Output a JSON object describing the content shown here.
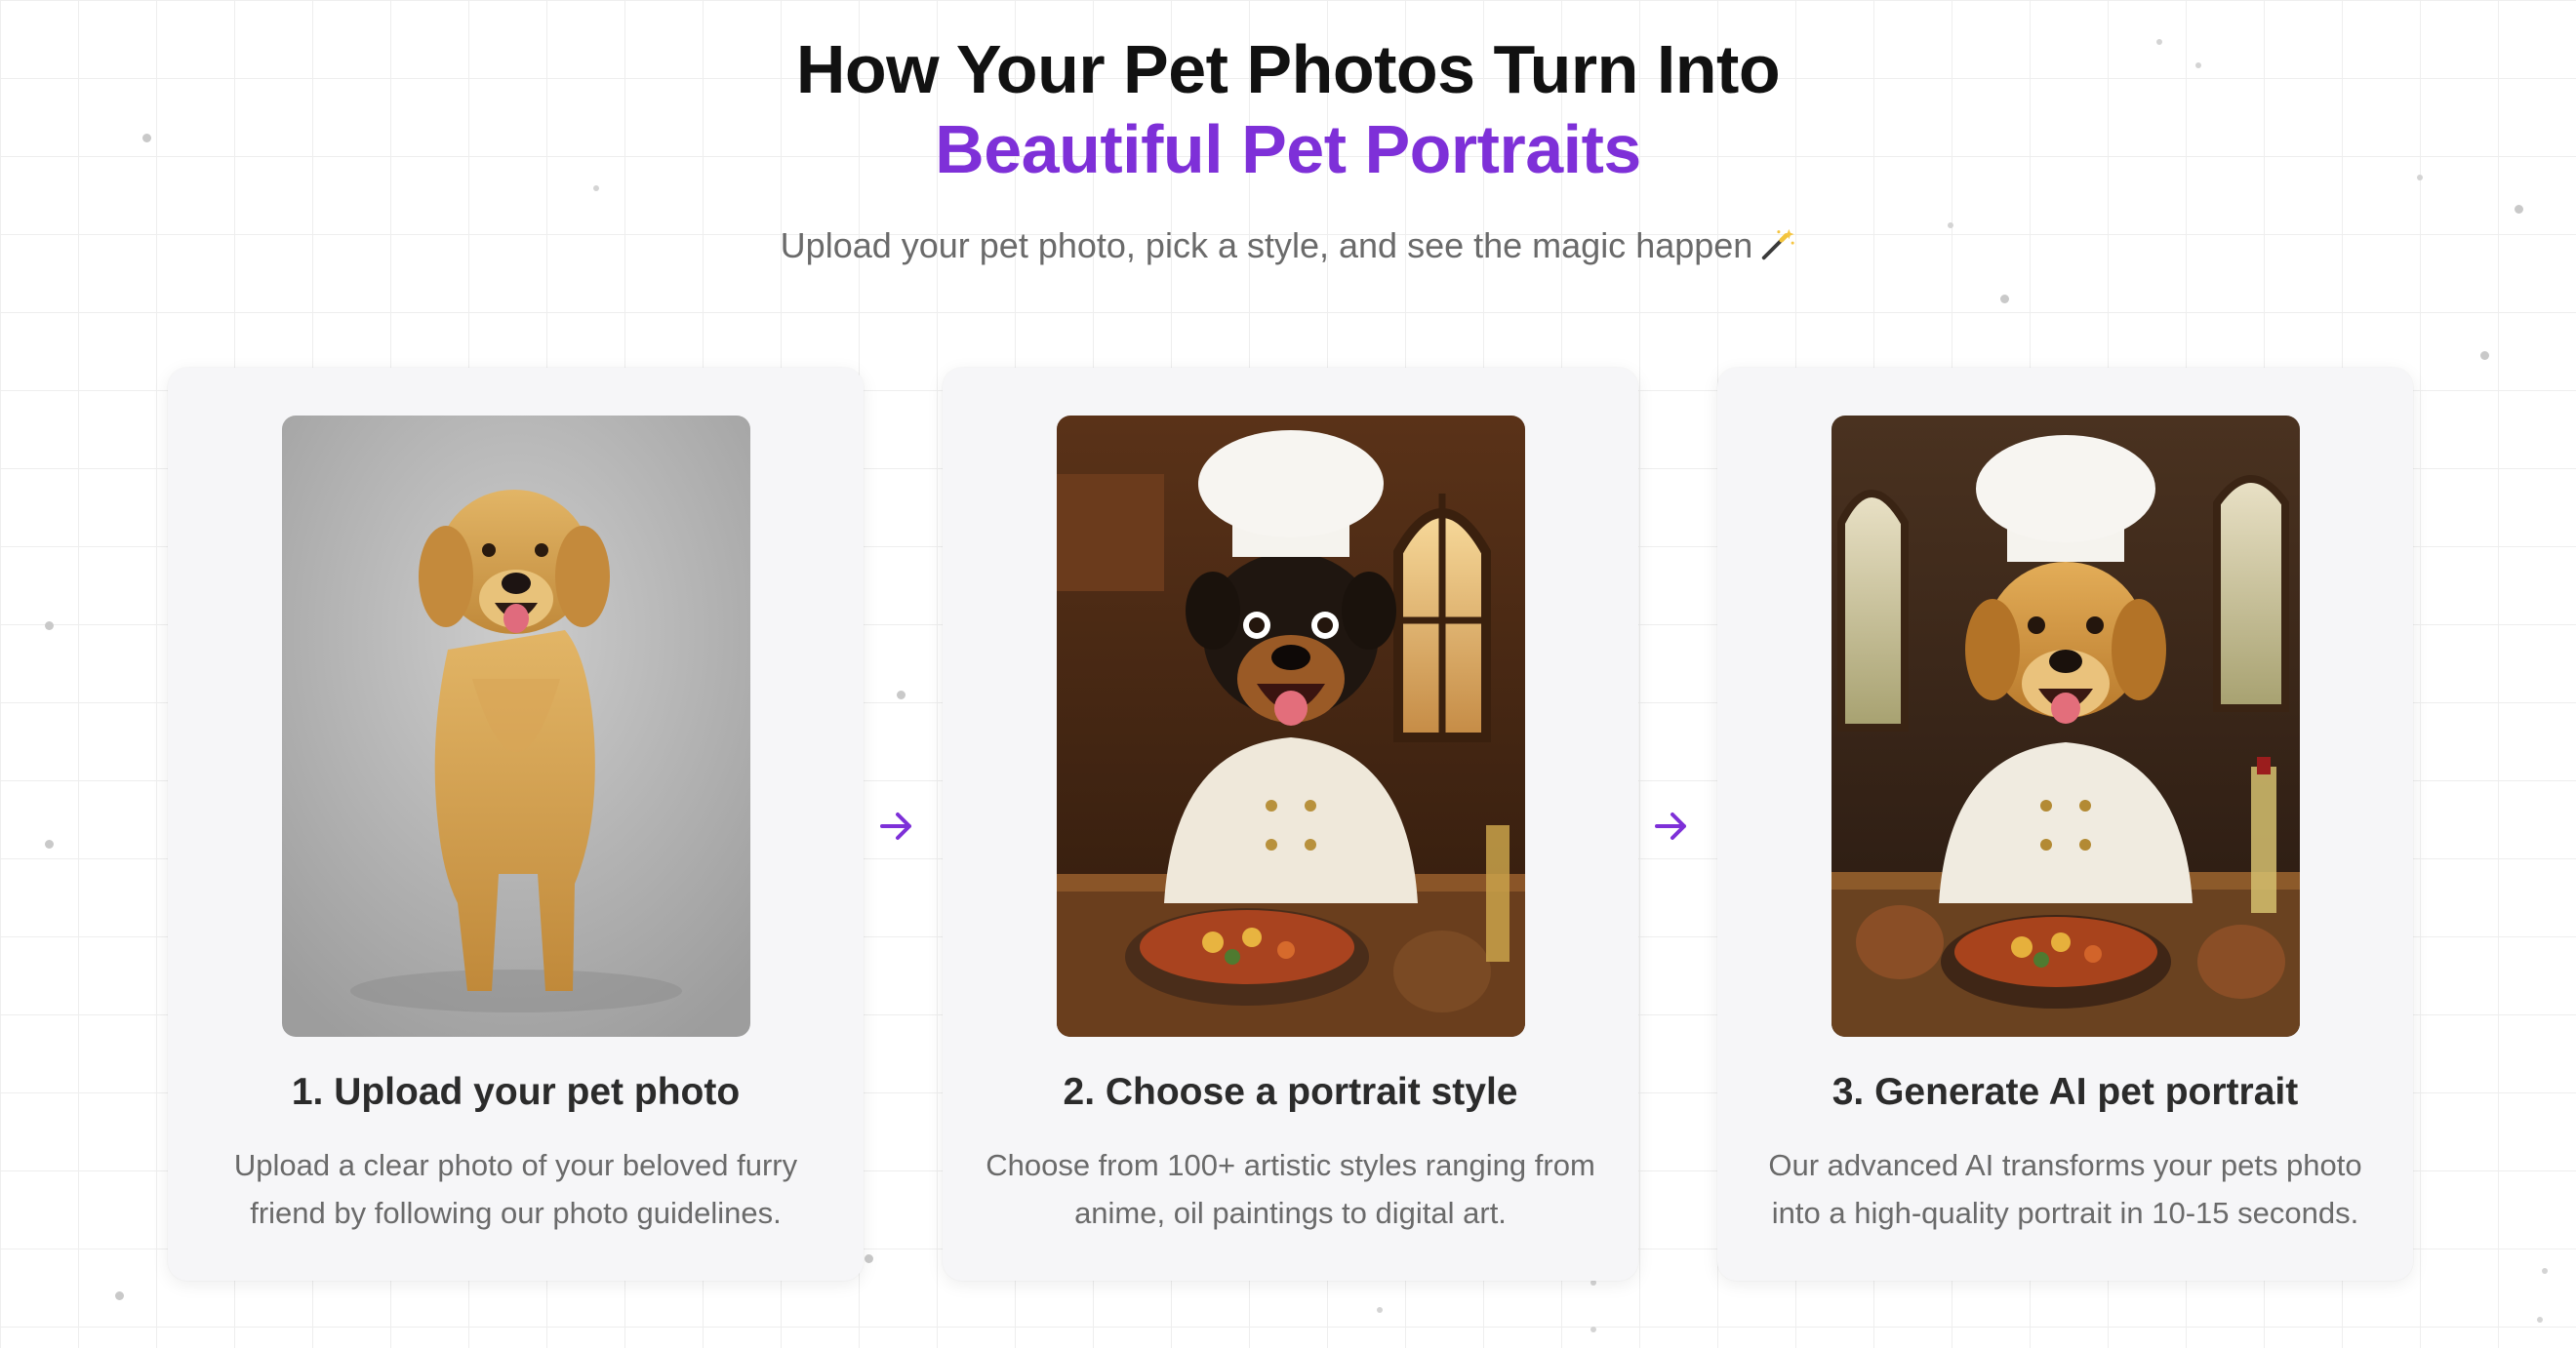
{
  "header": {
    "title_line1": "How Your Pet Photos Turn Into",
    "title_line2": "Beautiful Pet Portraits",
    "subtitle": "Upload your pet photo, pick a style, and see the magic happen"
  },
  "colors": {
    "accent": "#7e30d8",
    "card_bg": "#f6f6f8",
    "text_muted": "#6a6a6a"
  },
  "steps": [
    {
      "title": "1. Upload your pet photo",
      "description": "Upload a clear photo of your beloved furry friend by following our photo guidelines.",
      "image": "golden-retriever-studio-photo"
    },
    {
      "title": "2. Choose a portrait style",
      "description": "Choose from 100+ artistic styles ranging from anime, oil paintings to digital art.",
      "image": "rottweiler-chef-portrait"
    },
    {
      "title": "3. Generate AI pet portrait",
      "description": "Our advanced AI transforms your pets photo into a high-quality portrait in 10-15 seconds.",
      "image": "golden-retriever-chef-portrait"
    }
  ],
  "icons": {
    "subtitle_icon": "magic-wand-icon",
    "step_connector": "arrow-right-icon"
  }
}
